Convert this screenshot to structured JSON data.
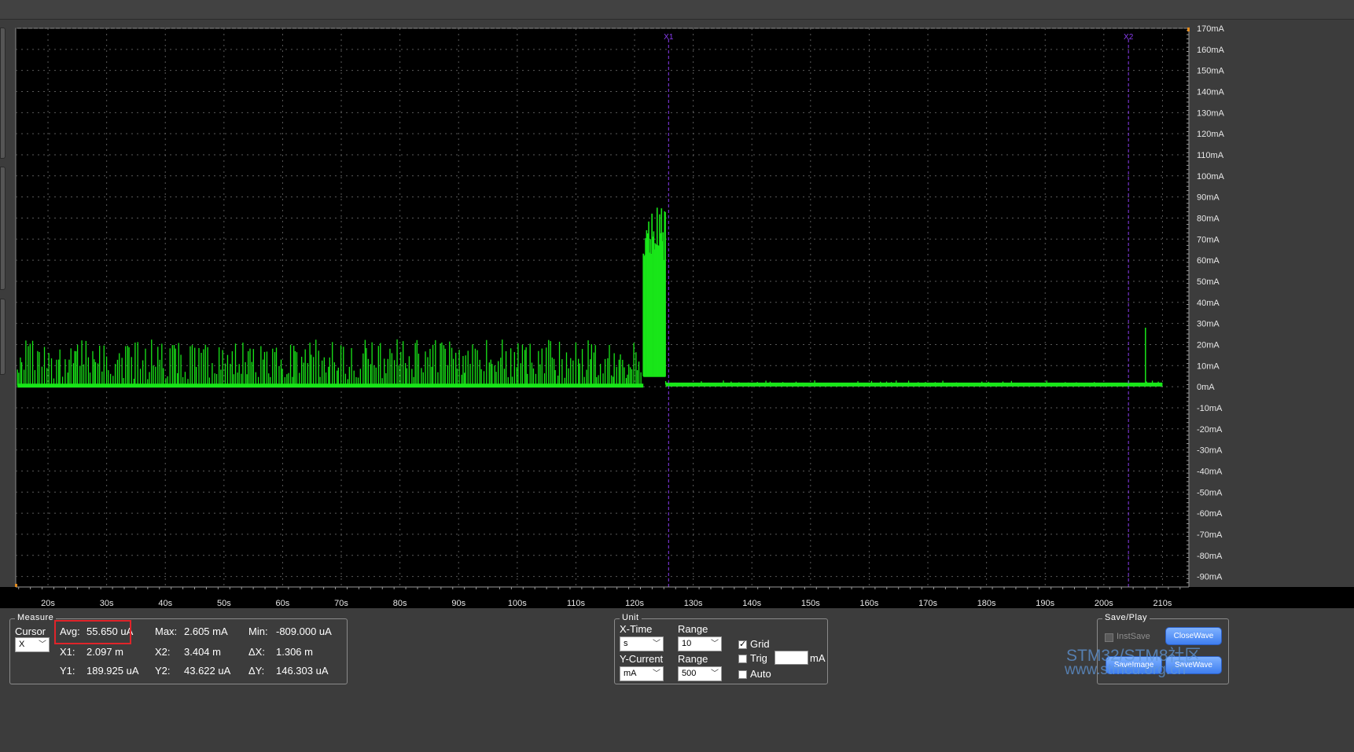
{
  "chart_data": {
    "type": "line",
    "xlim": [
      14.5,
      214.5
    ],
    "ylim": [
      -95,
      170
    ],
    "x_ticks": [
      "20s",
      "30s",
      "40s",
      "50s",
      "60s",
      "70s",
      "80s",
      "90s",
      "100s",
      "110s",
      "120s",
      "130s",
      "140s",
      "150s",
      "160s",
      "170s",
      "180s",
      "190s",
      "200s",
      "210s"
    ],
    "x_tick_values": [
      20,
      30,
      40,
      50,
      60,
      70,
      80,
      90,
      100,
      110,
      120,
      130,
      140,
      150,
      160,
      170,
      180,
      190,
      200,
      210
    ],
    "y_ticks": [
      "170mA",
      "160mA",
      "150mA",
      "140mA",
      "130mA",
      "120mA",
      "110mA",
      "100mA",
      "90mA",
      "80mA",
      "70mA",
      "60mA",
      "50mA",
      "40mA",
      "30mA",
      "20mA",
      "10mA",
      "0mA",
      "-10mA",
      "-20mA",
      "-30mA",
      "-40mA",
      "-50mA",
      "-60mA",
      "-70mA",
      "-80mA",
      "-90mA"
    ],
    "y_tick_values": [
      170,
      160,
      150,
      140,
      130,
      120,
      110,
      100,
      90,
      80,
      70,
      60,
      50,
      40,
      30,
      20,
      10,
      0,
      -10,
      -20,
      -30,
      -40,
      -50,
      -60,
      -70,
      -80,
      -90
    ],
    "grid": true,
    "cursors": [
      {
        "label": "X1",
        "x": 125.8
      },
      {
        "label": "X2",
        "x": 204.2
      }
    ],
    "series": [
      {
        "color": "#19e619",
        "segments": [
          {
            "x_start": 14.8,
            "x_end": 121.5,
            "baseline": 0.5,
            "spike_min": 3,
            "spike_max": 22
          },
          {
            "x_start": 121.5,
            "x_end": 125.3,
            "baseline": 5,
            "spike_min": 55,
            "spike_max": 80
          },
          {
            "x_start": 125.3,
            "x_end": 210,
            "baseline": 1,
            "spike_min": 0,
            "spike_max": 2
          }
        ],
        "points": [
          [
            207.1,
            28
          ]
        ]
      }
    ]
  },
  "measure": {
    "title": "Measure",
    "cursor_label": "Cursor",
    "cursor_value": "X",
    "avg_label": "Avg:",
    "avg_value": "55.650 uA",
    "max_label": "Max:",
    "max_value": "2.605 mA",
    "min_label": "Min:",
    "min_value": "-809.000 uA",
    "x1_label": "X1:",
    "x1_value": "2.097 m",
    "x2_label": "X2:",
    "x2_value": "3.404 m",
    "dx_label": "ΔX:",
    "dx_value": "1.306 m",
    "y1_label": "Y1:",
    "y1_value": "189.925 uA",
    "y2_label": "Y2:",
    "y2_value": "43.622 uA",
    "dy_label": "ΔY:",
    "dy_value": "146.303 uA"
  },
  "unit": {
    "title": "Unit",
    "xtime_label": "X-Time",
    "xtime_value": "s",
    "range1_label": "Range",
    "range1_value": "10",
    "ycurrent_label": "Y-Current",
    "ycurrent_value": "mA",
    "range2_label": "Range",
    "range2_value": "500",
    "grid_label": "Grid",
    "grid_checked": true,
    "trig_label": "Trig",
    "trig_checked": false,
    "trig_unit": "mA",
    "auto_label": "Auto",
    "auto_checked": false
  },
  "save_play": {
    "title": "Save/Play",
    "instsave_label": "InstSave",
    "close_wave_label": "CloseWave",
    "save_image_label": "SaveImage",
    "save_wave_label": "SaveWave"
  },
  "watermark": {
    "line1": "STM32/STM8社区",
    "line2": "www.stmcu.org.cn"
  },
  "colors": {
    "trace": "#19e619",
    "cursor": "#8a3cf0",
    "grid": "#5a5a5a",
    "highlight": "#e0242a"
  }
}
